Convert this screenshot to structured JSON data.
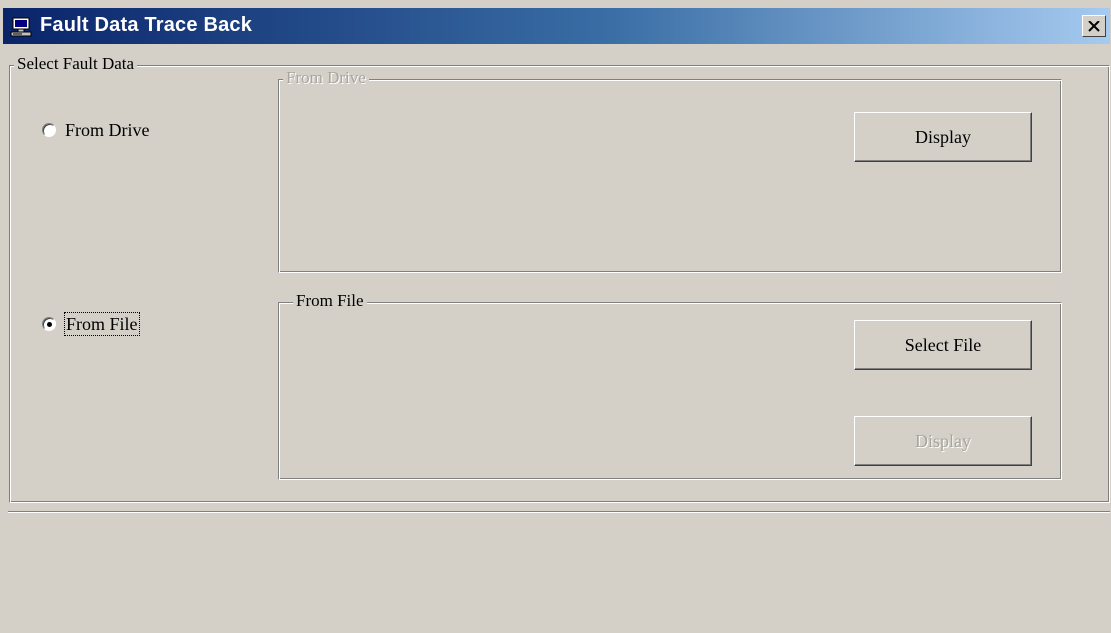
{
  "window": {
    "title": "Fault Data Trace Back",
    "close_symbol": "×",
    "app_icon": "computer-icon"
  },
  "select_group": {
    "legend": "Select Fault Data"
  },
  "radios": {
    "from_drive": {
      "label": "From Drive",
      "checked": false
    },
    "from_file": {
      "label": "From File",
      "checked": true
    }
  },
  "drive_group": {
    "legend": "From Drive",
    "enabled": false,
    "display_button": "Display"
  },
  "file_group": {
    "legend": "From File",
    "enabled": true,
    "select_file_button": "Select File",
    "display_button": "Display",
    "display_enabled": false
  },
  "colors": {
    "titlebar_start": "#0a246a",
    "titlebar_end": "#a6caf0",
    "face": "#d4d0c8",
    "disabled_text": "#a8a59e"
  }
}
